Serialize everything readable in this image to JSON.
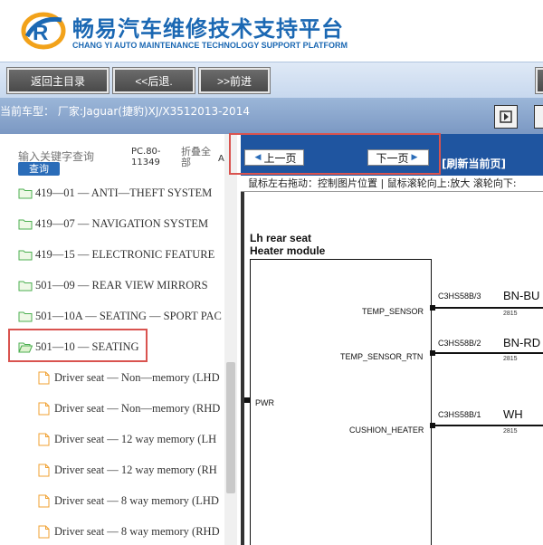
{
  "header": {
    "brand_cn": "畅易汽车维修技术支持平台",
    "brand_en": "CHANG YI AUTO MAINTENANCE TECHNOLOGY SUPPORT PLATFORM",
    "brand_color": "#1b68b3"
  },
  "toolbar": {
    "home_label": "返回主目录",
    "back_label": "<<后退.",
    "forward_label": ">>前进"
  },
  "carbar": {
    "text": "当前车型：  厂家:Jaguar(捷豹)XJ/X3512013-2014"
  },
  "left": {
    "search_placeholder": "输入关键字查询",
    "search_button": "查询",
    "pc_label": "PC.80-11349",
    "collapse_label": "折叠全部",
    "a_label": "A",
    "tree": [
      {
        "label": "419—01 — ANTI—THEFT SYSTEM",
        "type": "folder"
      },
      {
        "label": "419—07 — NAVIGATION SYSTEM",
        "type": "folder"
      },
      {
        "label": "419—15 — ELECTRONIC FEATURE",
        "type": "folder"
      },
      {
        "label": "501—09 — REAR VIEW MIRRORS",
        "type": "folder"
      },
      {
        "label": "501—10A — SEATING — SPORT PAC",
        "type": "folder"
      },
      {
        "label": "501—10 — SEATING",
        "type": "folder-open"
      },
      {
        "label": "Driver seat — Non—memory (LHD",
        "type": "doc"
      },
      {
        "label": "Driver seat — Non—memory (RHD",
        "type": "doc"
      },
      {
        "label": "Driver seat — 12 way memory (LH",
        "type": "doc"
      },
      {
        "label": "Driver seat — 12 way memory (RH",
        "type": "doc"
      },
      {
        "label": "Driver seat — 8 way memory (LHD",
        "type": "doc"
      },
      {
        "label": "Driver seat — 8 way memory (RHD",
        "type": "doc"
      }
    ]
  },
  "viewer": {
    "prev_label": "上一页",
    "next_label": "下一页",
    "refresh_label": "[刷新当前页]",
    "hint": "鼠标左右拖动：控制图片位置 | 鼠标滚轮向上:放大  滚轮向下:",
    "module_title_line1": "Lh rear seat",
    "module_title_line2": "Heater module",
    "pins": {
      "temp_sensor": "TEMP_SENSOR",
      "temp_sensor_rtn": "TEMP_SENSOR_RTN",
      "pwr": "PWR",
      "cushion_heater": "CUSHION_HEATER"
    },
    "connectors": {
      "c1": "C3HS58B/3",
      "c2": "C3HS58B/2",
      "c3": "C3HS58B/1"
    },
    "wires": {
      "w1": "BN-BU",
      "w2": "BN-RD",
      "w3": "WH",
      "n1": "2815",
      "n2": "2815",
      "n3": "2815"
    }
  }
}
